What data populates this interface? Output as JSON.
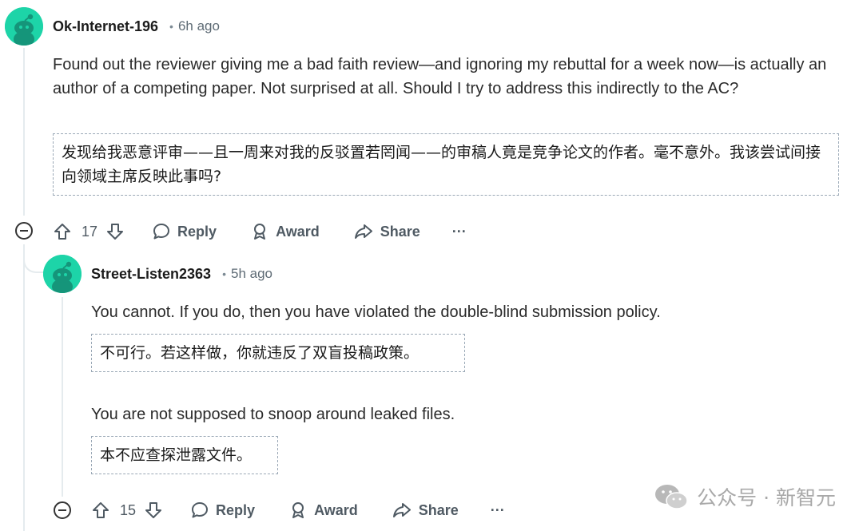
{
  "colors": {
    "avatar_bg": "#1dd4a8",
    "action_text": "#4f5a63",
    "thread_line": "#e5ebee"
  },
  "comment1": {
    "username": "Ok-Internet-196",
    "separator": "•",
    "time": "6h ago",
    "body": "Found out the reviewer giving me a bad faith review—and ignoring my rebuttal for a week now—is actually an author of a competing paper. Not surprised at all. Should I try to address this indirectly to the AC?",
    "translation": "发现给我恶意评审——且一周来对我的反驳置若罔闻——的审稿人竟是竞争论文的作者。毫不意外。我该尝试间接向领域主席反映此事吗?",
    "votes": "17",
    "reply_label": "Reply",
    "award_label": "Award",
    "share_label": "Share",
    "more_label": "···"
  },
  "comment2": {
    "username": "Street-Listen2363",
    "separator": "•",
    "time": "5h ago",
    "body1": "You cannot. If you do, then you have violated the double-blind submission policy.",
    "translation1": "不可行。若这样做，你就违反了双盲投稿政策。",
    "body2": "You are not supposed to snoop around leaked files.",
    "translation2": "本不应查探泄露文件。",
    "votes": "15",
    "reply_label": "Reply",
    "award_label": "Award",
    "share_label": "Share",
    "more_label": "···"
  },
  "watermark": {
    "text": "公众号 · 新智元",
    "icon": "wechat-icon"
  }
}
